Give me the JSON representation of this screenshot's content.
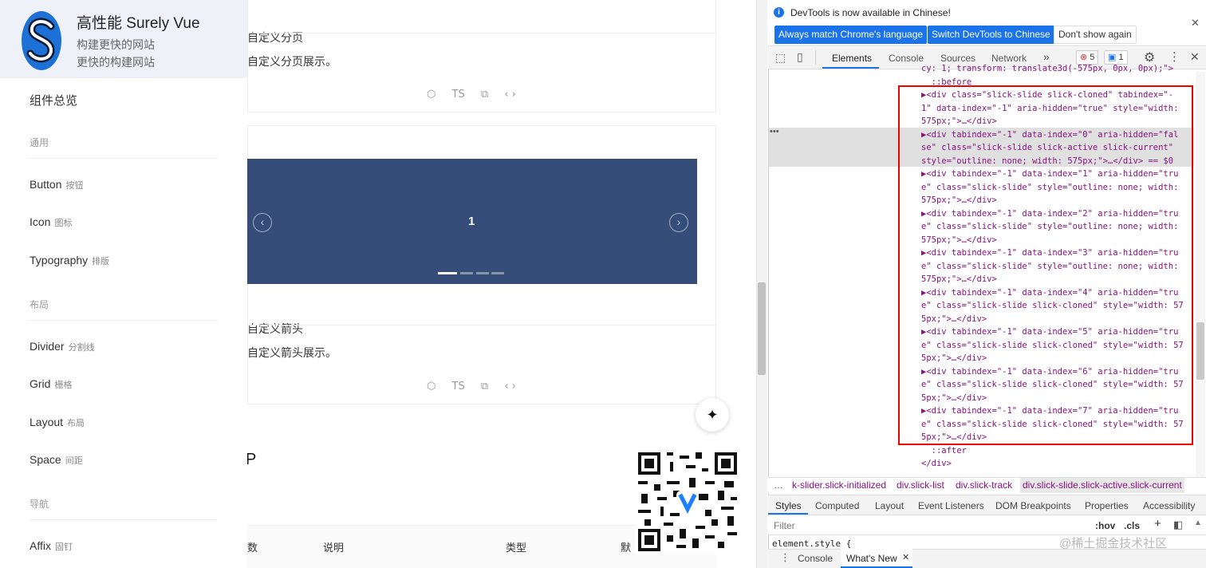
{
  "brand": {
    "title": "高性能 Surely Vue",
    "subtitle1": "构建更快的网站",
    "subtitle2": "更快的构建网站"
  },
  "sidebar": {
    "overview": "组件总览",
    "group_general": "通用",
    "group_layout": "布局",
    "group_nav": "导航",
    "items": [
      {
        "label": "Button",
        "zh": "按钮"
      },
      {
        "label": "Icon",
        "zh": "图标"
      },
      {
        "label": "Typography",
        "zh": "排版"
      },
      {
        "label": "Divider",
        "zh": "分割线"
      },
      {
        "label": "Grid",
        "zh": "栅格"
      },
      {
        "label": "Layout",
        "zh": "布局"
      },
      {
        "label": "Space",
        "zh": "间距"
      },
      {
        "label": "Affix",
        "zh": "固钉"
      }
    ]
  },
  "main": {
    "section1_title": "自定义分页",
    "section1_desc": "自定义分页展示。",
    "section2_title": "自定义箭头",
    "section2_desc": "自定义箭头展示。",
    "ts_label": "TS",
    "slide_number": "1",
    "table_headers": [
      "数",
      "说明",
      "类型",
      "默"
    ],
    "cursor_char": "P"
  },
  "devtools": {
    "info_text": "DevTools is now available in Chinese!",
    "btn_match": "Always match Chrome's language",
    "btn_switch": "Switch DevTools to Chinese",
    "btn_dont": "Don't show again",
    "tabs": [
      "Elements",
      "Console",
      "Sources",
      "Network"
    ],
    "more": "»",
    "error_count": "5",
    "msg_count": "1",
    "code_lines": [
      "cy: 1; transform: translate3d(-575px, 0px, 0px);\">",
      "  ::before",
      "▶<div class=\"slick-slide slick-cloned\" tabindex=\"-",
      "1\" data-index=\"-1\" aria-hidden=\"true\" style=\"width:",
      "575px;\">…</div>",
      "▶<div tabindex=\"-1\" data-index=\"0\" aria-hidden=\"fal",
      "se\" class=\"slick-slide slick-active slick-current\"",
      "style=\"outline: none; width: 575px;\">…</div> == $0",
      "▶<div tabindex=\"-1\" data-index=\"1\" aria-hidden=\"tru",
      "e\" class=\"slick-slide\" style=\"outline: none; width:",
      "575px;\">…</div>",
      "▶<div tabindex=\"-1\" data-index=\"2\" aria-hidden=\"tru",
      "e\" class=\"slick-slide\" style=\"outline: none; width:",
      "575px;\">…</div>",
      "▶<div tabindex=\"-1\" data-index=\"3\" aria-hidden=\"tru",
      "e\" class=\"slick-slide\" style=\"outline: none; width:",
      "575px;\">…</div>",
      "▶<div tabindex=\"-1\" data-index=\"4\" aria-hidden=\"tru",
      "e\" class=\"slick-slide slick-cloned\" style=\"width: 57",
      "5px;\">…</div>",
      "▶<div tabindex=\"-1\" data-index=\"5\" aria-hidden=\"tru",
      "e\" class=\"slick-slide slick-cloned\" style=\"width: 57",
      "5px;\">…</div>",
      "▶<div tabindex=\"-1\" data-index=\"6\" aria-hidden=\"tru",
      "e\" class=\"slick-slide slick-cloned\" style=\"width: 57",
      "5px;\">…</div>",
      "▶<div tabindex=\"-1\" data-index=\"7\" aria-hidden=\"tru",
      "e\" class=\"slick-slide slick-cloned\" style=\"width: 57",
      "5px;\">…</div>",
      "  ::after",
      "</div>"
    ],
    "ellipsis": "…",
    "crumbs": [
      "k-slider.slick-initialized",
      "div.slick-list",
      "div.slick-track",
      "div.slick-slide.slick-active.slick-current"
    ],
    "style_tabs": [
      "Styles",
      "Computed",
      "Layout",
      "Event Listeners",
      "DOM Breakpoints",
      "Properties",
      "Accessibility"
    ],
    "filter_placeholder": "Filter",
    "hov": ":hov",
    "cls": ".cls",
    "element_style": "element.style {",
    "drawer_tabs": [
      "Console",
      "What's New"
    ],
    "watermark": "@稀土掘金技术社区",
    "eq0": "== $0"
  },
  "colors": {
    "carousel": "#364d79",
    "accent": "#1a73e8",
    "highlight": "#e00000"
  }
}
